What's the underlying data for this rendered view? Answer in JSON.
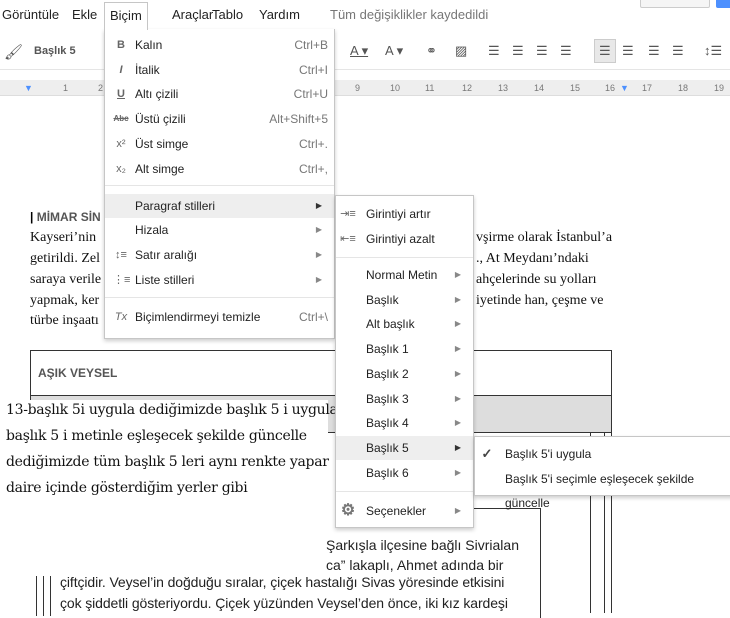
{
  "menubar": {
    "items": [
      "Görüntüle",
      "Ekle",
      "Biçim",
      "Araçlar",
      "Tablo",
      "Yardım"
    ],
    "status": "Tüm değişiklikler kaydedildi"
  },
  "toolbar": {
    "style": "Başlık 5"
  },
  "ruler": {
    "numbers": [
      "1",
      "2",
      "9",
      "10",
      "11",
      "12",
      "13",
      "14",
      "15",
      "16",
      "17",
      "18",
      "19"
    ]
  },
  "format_menu": {
    "items": [
      {
        "icon": "bold-icon",
        "glyph": "B",
        "label": "Kalın",
        "shortcut": "Ctrl+B"
      },
      {
        "icon": "italic-icon",
        "glyph": "I",
        "label": "İtalik",
        "shortcut": "Ctrl+I"
      },
      {
        "icon": "underline-icon",
        "glyph": "U",
        "label": "Altı çizili",
        "shortcut": "Ctrl+U"
      },
      {
        "icon": "strikethrough-icon",
        "glyph": "Abc",
        "label": "Üstü çizili",
        "shortcut": "Alt+Shift+5"
      },
      {
        "icon": "superscript-icon",
        "glyph": "x²",
        "label": "Üst simge",
        "shortcut": "Ctrl+."
      },
      {
        "icon": "subscript-icon",
        "glyph": "x₂",
        "label": "Alt simge",
        "shortcut": "Ctrl+,"
      },
      {
        "icon": "",
        "glyph": "",
        "label": "Paragraf stilleri",
        "shortcut": "",
        "submenu": true
      },
      {
        "icon": "",
        "glyph": "",
        "label": "Hizala",
        "shortcut": "",
        "submenu": true
      },
      {
        "icon": "line-spacing-icon",
        "glyph": "↕≡",
        "label": "Satır aralığı",
        "shortcut": "",
        "submenu": true
      },
      {
        "icon": "list-icon",
        "glyph": "⋮≡",
        "label": "Liste stilleri",
        "shortcut": "",
        "submenu": true
      },
      {
        "icon": "clear-formatting-icon",
        "glyph": "Tx",
        "label": "Biçimlendirmeyi temizle",
        "shortcut": "Ctrl+\\"
      }
    ]
  },
  "paragraph_menu": {
    "indent": [
      "Girintiyi artır",
      "Girintiyi azalt"
    ],
    "styles": [
      "Normal Metin",
      "Başlık",
      "Alt başlık",
      "Başlık 1",
      "Başlık 2",
      "Başlık 3",
      "Başlık 4",
      "Başlık 5",
      "Başlık 6"
    ],
    "options": "Seçenekler",
    "highlighted": "Başlık 5"
  },
  "heading5_menu": {
    "items": [
      "Başlık 5'i uygula",
      "Başlık 5'i seçimle eşleşecek şekilde güncelle"
    ],
    "checked": "Başlık 5'i uygula"
  },
  "document": {
    "heading": "MİMAR SİN",
    "para_left": [
      "Kayseri’nin",
      "getirildi. Zel",
      "saraya verile",
      "yapmak, ker",
      "türbe inşaatı"
    ],
    "para_right": [
      "vşirme olarak İstanbul’a",
      "., At Meydanı’ndaki",
      "ahçelerinde su yolları",
      "iyetinde han, çeşme ve",
      ""
    ],
    "table_title": "AŞIK VEYSEL",
    "body_lines": [
      "Şarkışla ilçesine bağlı Sivrialan",
      "ca” lakaplı, Ahmet adında bir",
      "çiftçidir. Veysel’in doğduğu sıralar, çiçek hastalığı Sivas yöresinde etkisini",
      "çok şiddetli gösteriyordu. Çiçek yüzünden Veysel’den önce, iki kız kardeşi"
    ]
  },
  "annotation": {
    "lines": [
      "13-başlık 5i uygula dediğimizde başlık 5 i uygular",
      "başlık 5 i metinle  eşleşecek şekilde güncelle",
      "dediğimizde tüm başlık 5 leri aynı renkte yapar",
      "daire içinde gösterdiğim yerler gibi"
    ]
  }
}
